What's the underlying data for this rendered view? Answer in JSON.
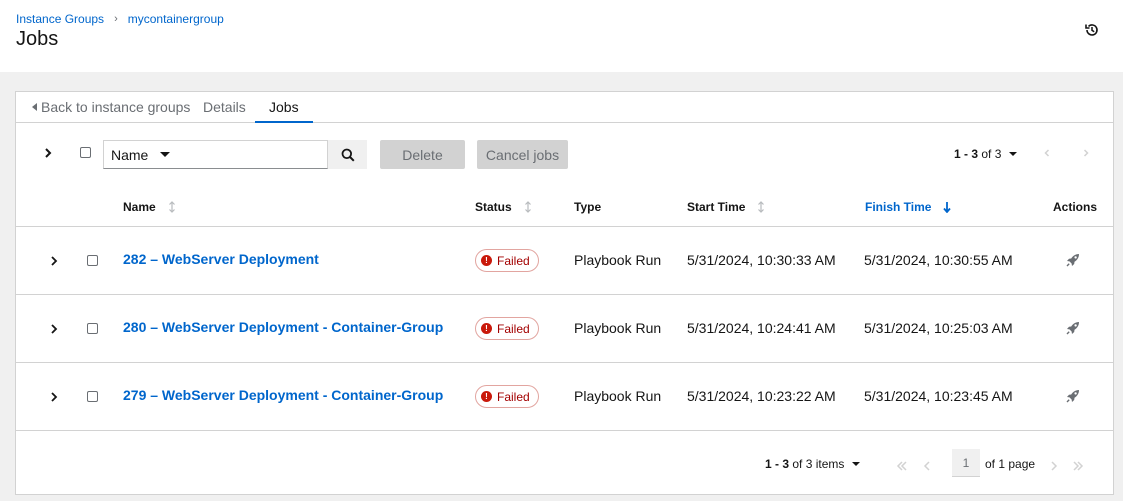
{
  "breadcrumb": {
    "root": "Instance Groups",
    "current": "mycontainergroup"
  },
  "page_title": "Jobs",
  "tabs": {
    "back": "Back to instance groups",
    "details": "Details",
    "jobs": "Jobs"
  },
  "toolbar": {
    "filter_field": "Name",
    "search_value": "",
    "delete_label": "Delete",
    "cancel_label": "Cancel jobs",
    "pagination_range": "1 - 3",
    "pagination_of": "of 3"
  },
  "columns": {
    "name": "Name",
    "status": "Status",
    "type": "Type",
    "start_time": "Start Time",
    "finish_time": "Finish Time",
    "actions": "Actions"
  },
  "sort": {
    "column": "finish_time",
    "direction": "descending"
  },
  "jobs": [
    {
      "name": "282 – WebServer Deployment",
      "status": "Failed",
      "type": "Playbook Run",
      "start": "5/31/2024, 10:30:33 AM",
      "finish": "5/31/2024, 10:30:55 AM",
      "action_icon": "rocket-icon"
    },
    {
      "name": "280 – WebServer Deployment - Container-Group",
      "status": "Failed",
      "type": "Playbook Run",
      "start": "5/31/2024, 10:24:41 AM",
      "finish": "5/31/2024, 10:25:03 AM",
      "action_icon": "rocket-icon"
    },
    {
      "name": "279 – WebServer Deployment - Container-Group",
      "status": "Failed",
      "type": "Playbook Run",
      "start": "5/31/2024, 10:23:22 AM",
      "finish": "5/31/2024, 10:23:45 AM",
      "action_icon": "rocket-icon"
    }
  ],
  "footer": {
    "range": "1 - 3",
    "of_items": "of 3 items",
    "page": "1",
    "of_page": "of 1 page"
  },
  "colors": {
    "link": "#0066cc",
    "danger": "#c9190b",
    "border": "#d2d2d2",
    "background": "#f0f0f0"
  }
}
